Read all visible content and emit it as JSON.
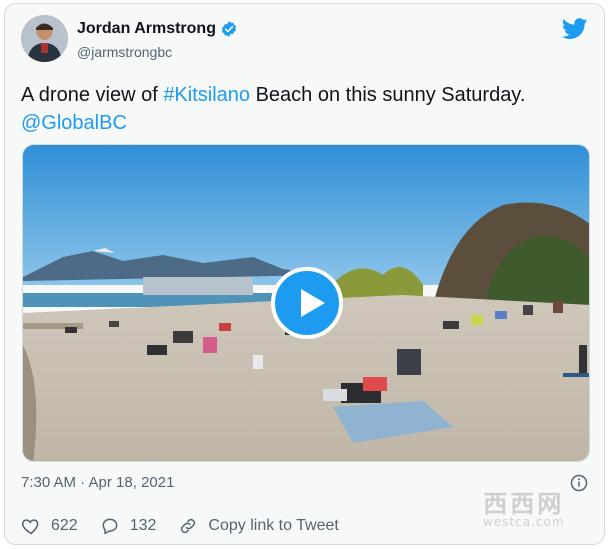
{
  "author": {
    "name": "Jordan Armstrong",
    "handle": "@jarmstrongbc",
    "verified": true,
    "avatar_icon": "avatar-photo"
  },
  "tweet": {
    "text_before": "A drone view of ",
    "hashtag": "#Kitsilano",
    "text_after": " Beach on this sunny Saturday.",
    "mention": "@GlobalBC"
  },
  "media": {
    "type": "video",
    "description_icon": "beach-drone-photo",
    "play_icon": "play-icon"
  },
  "meta": {
    "timestamp": "7:30 AM · Apr 18, 2021"
  },
  "actions": {
    "likes": "622",
    "replies": "132",
    "copy_link_label": "Copy link to Tweet"
  },
  "watermark": {
    "big": "西西网",
    "small": "westca.com"
  },
  "colors": {
    "accent": "#1d9bf0",
    "card_bg": "#f7f9f9",
    "border": "#cfd9de",
    "secondary_text": "#536471"
  }
}
